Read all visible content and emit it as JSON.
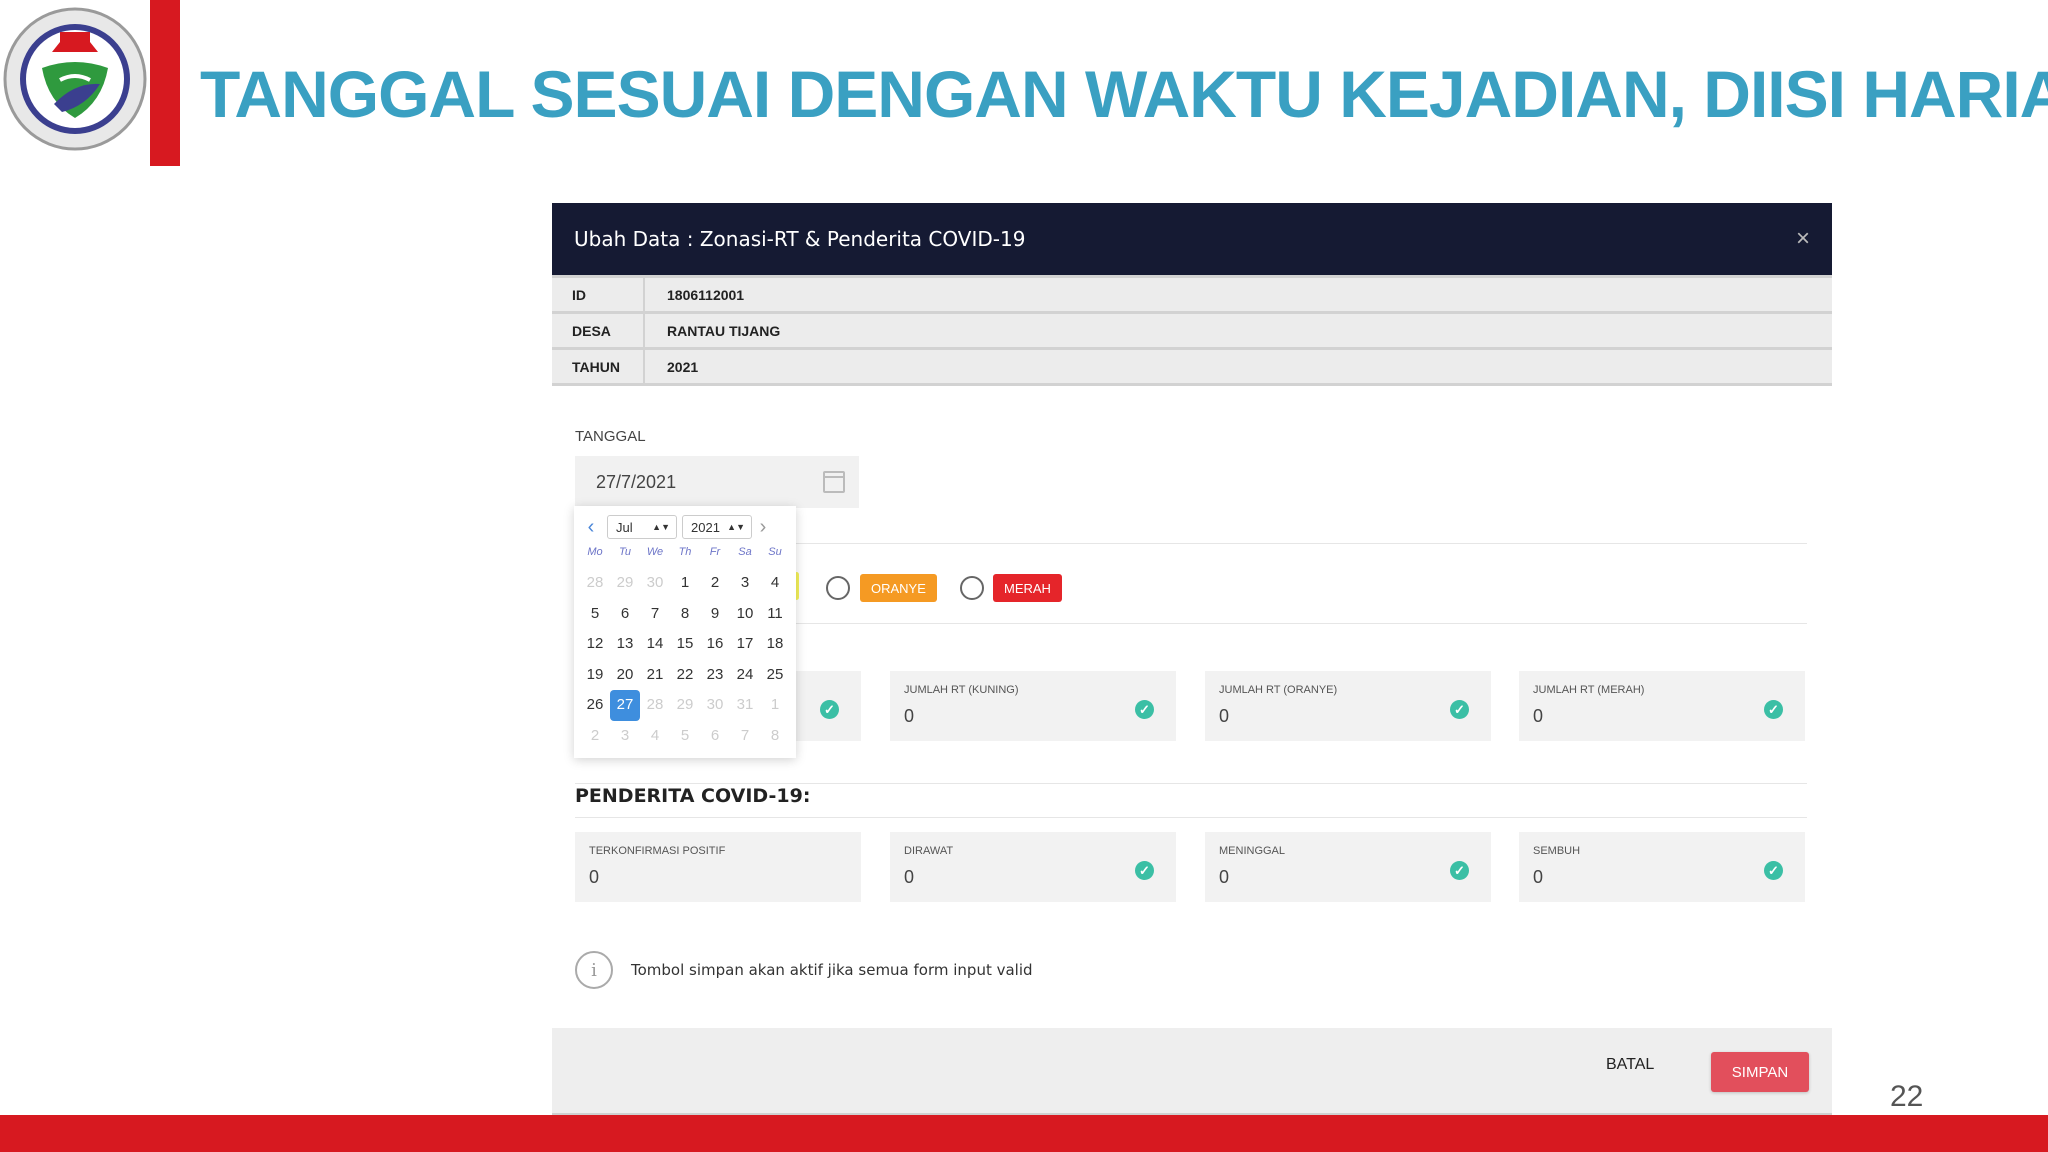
{
  "slide": {
    "title": "TANGGAL SESUAI DENGAN WAKTU KEJADIAN, DIISI HARIAN",
    "page_number": "22"
  },
  "modal": {
    "title": "Ubah Data : Zonasi-RT & Penderita COVID-19",
    "close_icon": "×",
    "info": [
      {
        "key": "ID",
        "value": "1806112001"
      },
      {
        "key": "DESA",
        "value": "RANTAU TIJANG"
      },
      {
        "key": "TAHUN",
        "value": "2021"
      }
    ],
    "tanggal_label": "TANGGAL",
    "tanggal_value": "27/7/2021",
    "zonasi_options": [
      "ORANYE",
      "MERAH"
    ],
    "rt_fields": [
      {
        "label": "JUMLAH RT (KUNING)",
        "value": "0"
      },
      {
        "label": "JUMLAH RT (ORANYE)",
        "value": "0"
      },
      {
        "label": "JUMLAH RT (MERAH)",
        "value": "0"
      }
    ],
    "section_penderita": "PENDERITA COVID-19:",
    "penderita_fields": [
      {
        "label": "TERKONFIRMASI POSITIF",
        "value": "0"
      },
      {
        "label": "DIRAWAT",
        "value": "0"
      },
      {
        "label": "MENINGGAL",
        "value": "0"
      },
      {
        "label": "SEMBUH",
        "value": "0"
      }
    ],
    "note": "Tombol simpan akan aktif jika semua form input valid",
    "batal_label": "BATAL",
    "simpan_label": "SIMPAN"
  },
  "datepicker": {
    "month": "Jul",
    "year": "2021",
    "weekdays": [
      "Mo",
      "Tu",
      "We",
      "Th",
      "Fr",
      "Sa",
      "Su"
    ],
    "days": [
      {
        "d": "28",
        "muted": true
      },
      {
        "d": "29",
        "muted": true
      },
      {
        "d": "30",
        "muted": true
      },
      {
        "d": "1"
      },
      {
        "d": "2"
      },
      {
        "d": "3"
      },
      {
        "d": "4"
      },
      {
        "d": "5"
      },
      {
        "d": "6"
      },
      {
        "d": "7"
      },
      {
        "d": "8"
      },
      {
        "d": "9"
      },
      {
        "d": "10"
      },
      {
        "d": "11"
      },
      {
        "d": "12"
      },
      {
        "d": "13"
      },
      {
        "d": "14"
      },
      {
        "d": "15"
      },
      {
        "d": "16"
      },
      {
        "d": "17"
      },
      {
        "d": "18"
      },
      {
        "d": "19"
      },
      {
        "d": "20"
      },
      {
        "d": "21"
      },
      {
        "d": "22"
      },
      {
        "d": "23"
      },
      {
        "d": "24"
      },
      {
        "d": "25"
      },
      {
        "d": "26"
      },
      {
        "d": "27",
        "selected": true
      },
      {
        "d": "28",
        "muted": true
      },
      {
        "d": "29",
        "muted": true
      },
      {
        "d": "30",
        "muted": true
      },
      {
        "d": "31",
        "muted": true
      },
      {
        "d": "1",
        "muted": true
      },
      {
        "d": "2",
        "muted": true
      },
      {
        "d": "3",
        "muted": true
      },
      {
        "d": "4",
        "muted": true
      },
      {
        "d": "5",
        "muted": true
      },
      {
        "d": "6",
        "muted": true
      },
      {
        "d": "7",
        "muted": true
      },
      {
        "d": "8",
        "muted": true
      }
    ]
  },
  "colors": {
    "title": "#3aa0c2",
    "red_accent": "#d71920",
    "modal_header": "#151a33",
    "selected_day": "#3e8ede",
    "simpan": "#e24f5c",
    "oranye": "#f59a23",
    "merah": "#e5252a",
    "check": "#3bbfa5"
  }
}
